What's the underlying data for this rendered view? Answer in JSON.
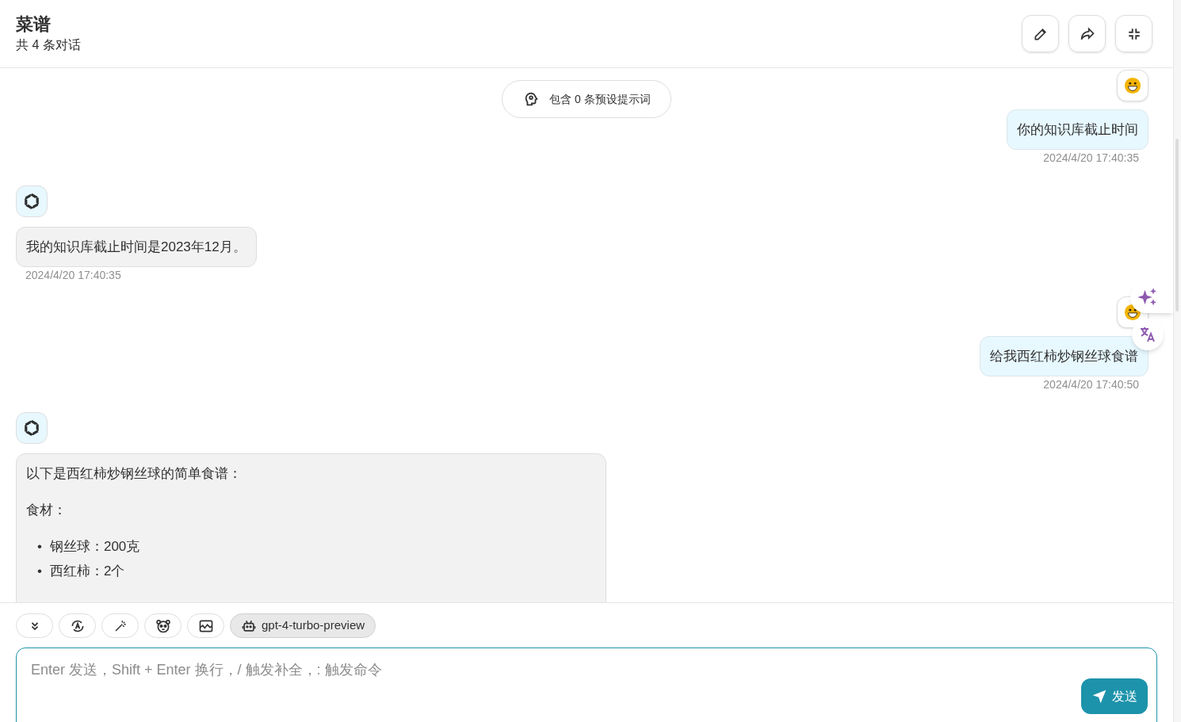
{
  "header": {
    "title": "菜谱",
    "subtitle": "共 4 条对话"
  },
  "prompt_badge": "包含 0 条预设提示词",
  "messages": [
    {
      "kind": "user",
      "text": "你的知识库截止时间",
      "time": "2024/4/20 17:40:35"
    },
    {
      "kind": "assistant",
      "text": "我的知识库截止时间是2023年12月。",
      "time": "2024/4/20 17:40:35"
    },
    {
      "kind": "user",
      "text": "给我西红柿炒钢丝球食谱",
      "time": "2024/4/20 17:40:50"
    },
    {
      "kind": "assistant",
      "blocks": [
        {
          "kind": "paragraph",
          "text": "以下是西红柿炒钢丝球的简单食谱："
        },
        {
          "kind": "paragraph",
          "text": "食材："
        },
        {
          "kind": "list",
          "items": [
            {
              "marker": "•",
              "text": "钢丝球：200克"
            },
            {
              "marker": "•",
              "text": "西红柿：2个"
            }
          ]
        }
      ]
    }
  ],
  "model": "gpt-4-turbo-preview",
  "input": {
    "placeholder": "Enter 发送，Shift + Enter 换行，/ 触发补全，: 触发命令"
  },
  "send_button": "发送"
}
